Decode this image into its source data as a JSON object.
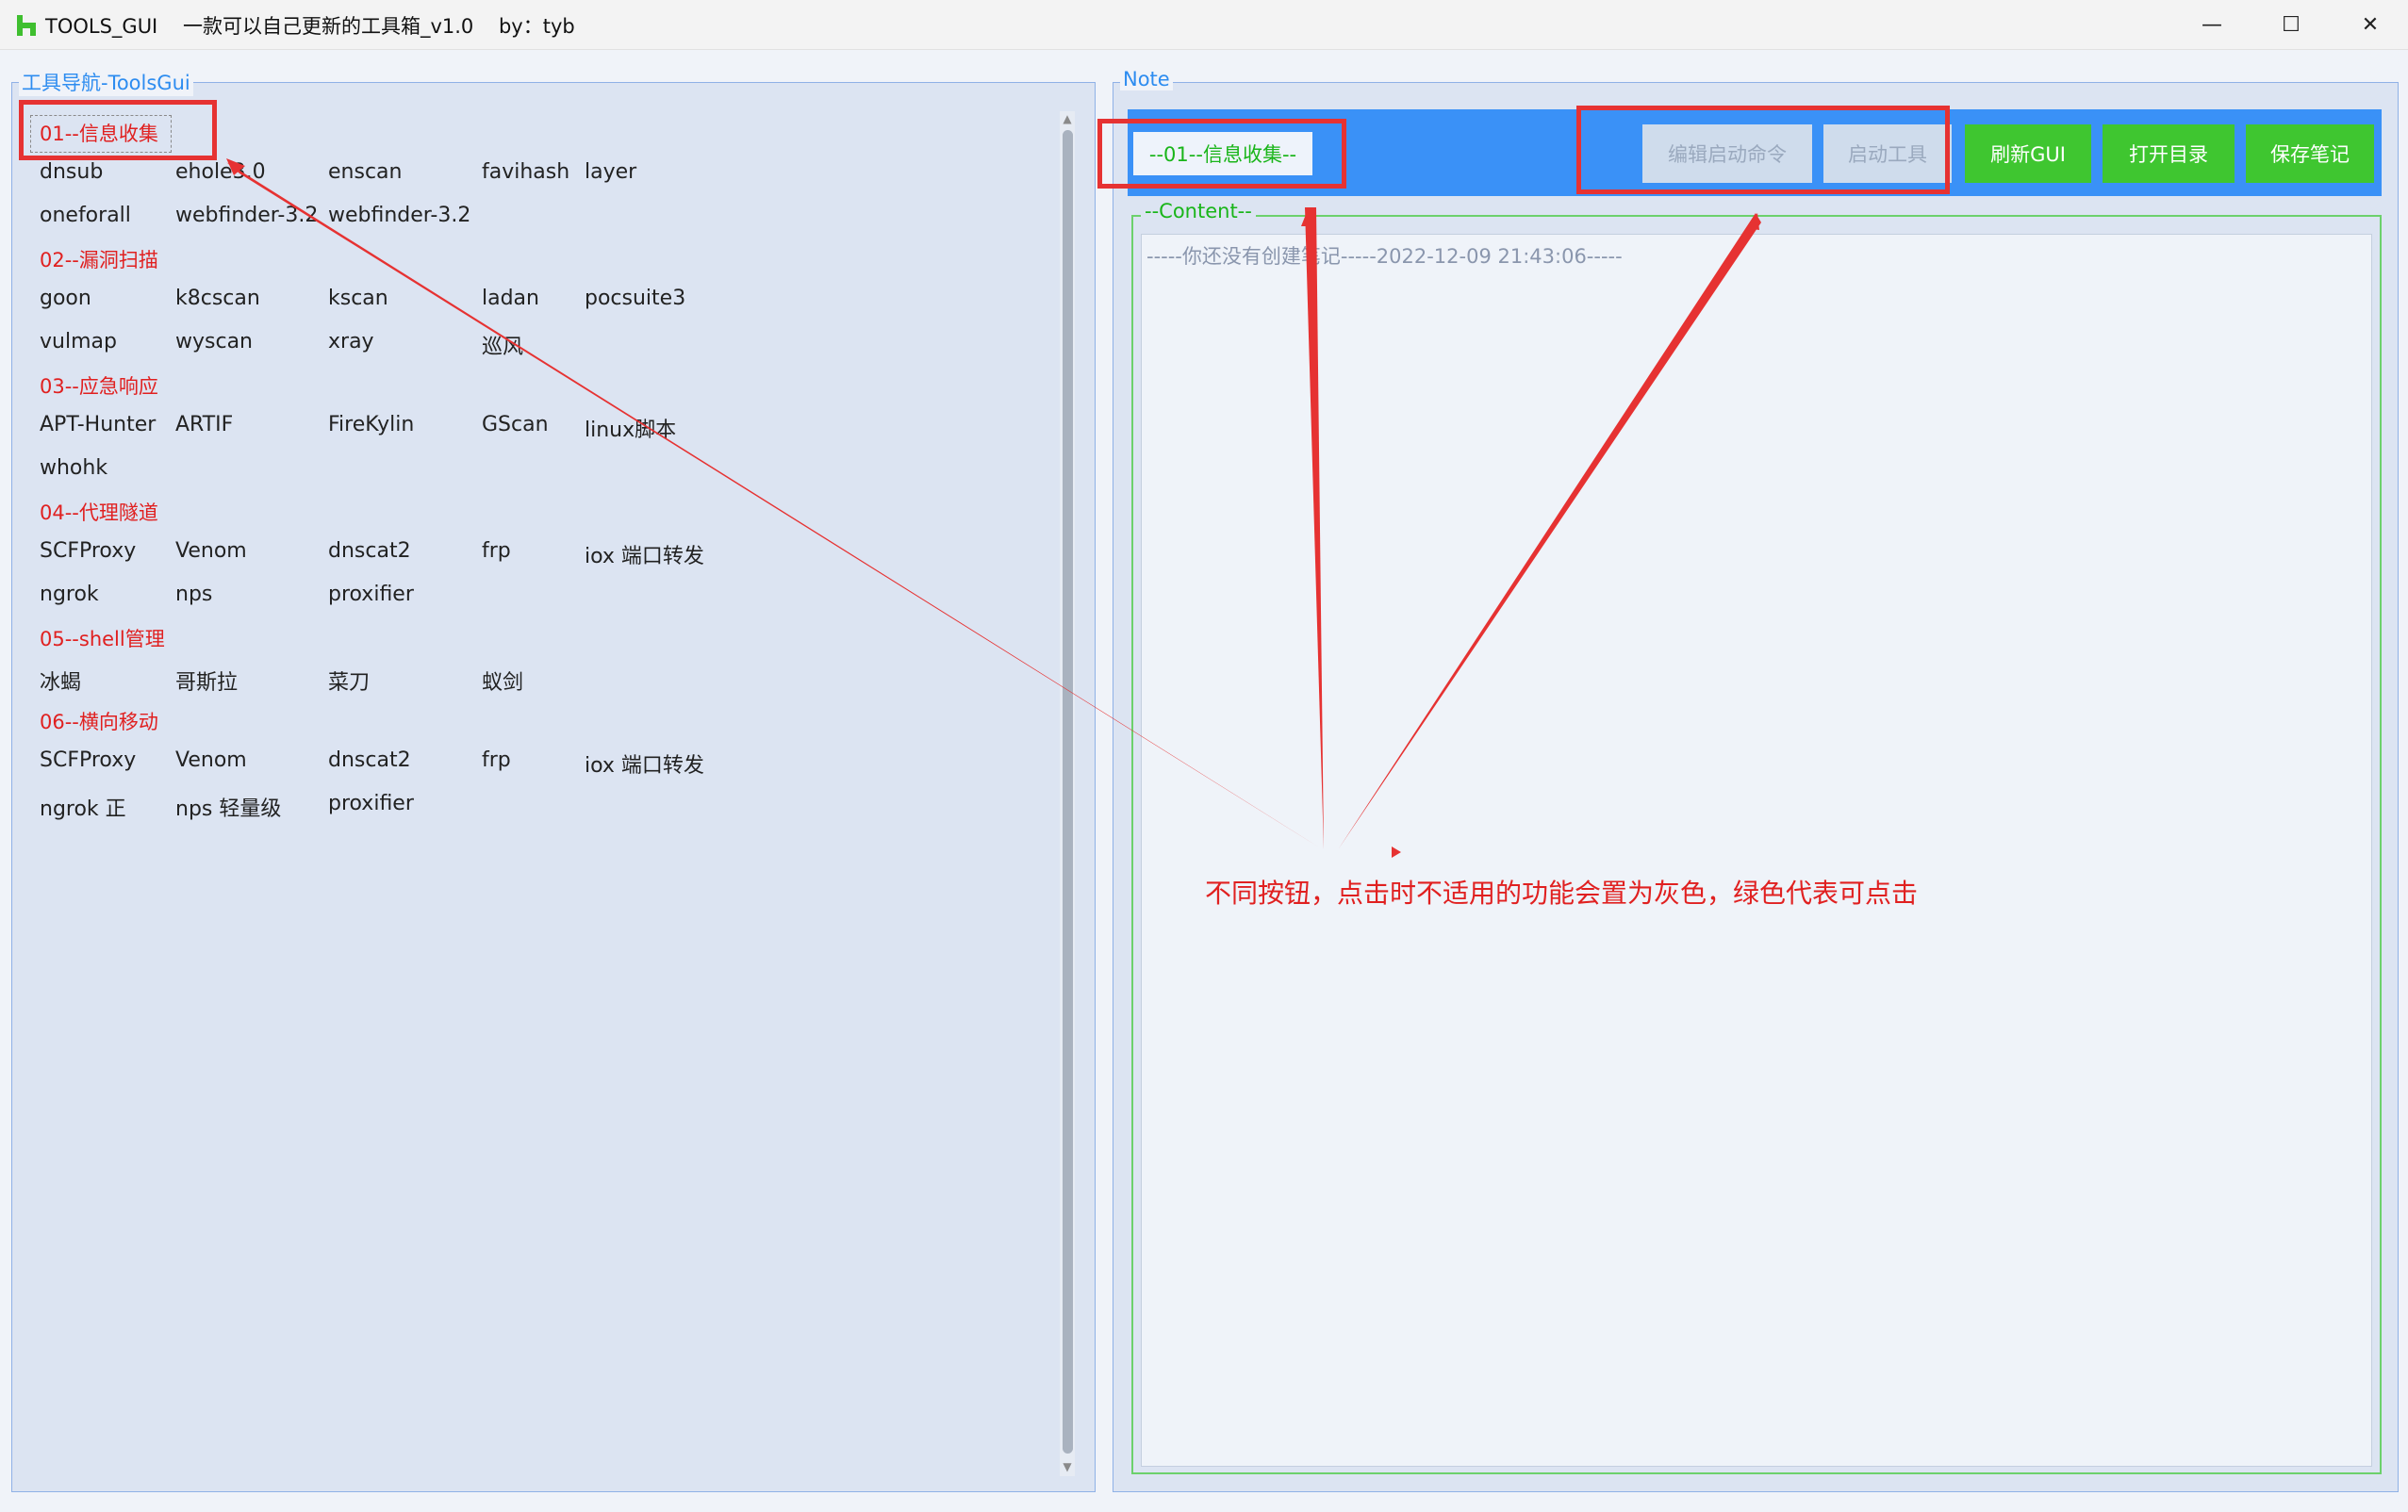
{
  "window": {
    "title": "TOOLS_GUI    一款可以自己更新的工具箱_v1.0    by：tyb",
    "controls": [
      "—",
      "☐",
      "✕"
    ]
  },
  "left_panel": {
    "title": "工具导航-ToolsGui",
    "categories": [
      {
        "label": "01--信息收集",
        "rows": [
          [
            "dnsub",
            "ehole3.0",
            "enscan",
            "favihash",
            "layer"
          ],
          [
            "oneforall",
            "webfinder-3.2",
            "webfinder-3.2"
          ]
        ]
      },
      {
        "label": "02--漏洞扫描",
        "rows": [
          [
            "goon",
            "k8cscan",
            "kscan",
            "ladan",
            "pocsuite3"
          ],
          [
            "vulmap",
            "wyscan",
            "xray",
            "巡风"
          ]
        ]
      },
      {
        "label": "03--应急响应",
        "rows": [
          [
            "APT-Hunter",
            "ARTIF",
            "FireKylin",
            "GScan",
            "linux脚本"
          ],
          [
            "whohk"
          ]
        ]
      },
      {
        "label": "04--代理隧道",
        "rows": [
          [
            "SCFProxy",
            "Venom",
            "dnscat2",
            "frp",
            "iox 端口转发"
          ],
          [
            "ngrok",
            "nps",
            "proxifier"
          ]
        ]
      },
      {
        "label": "05--shell管理",
        "rows": [
          [
            "冰蝎",
            "哥斯拉",
            "菜刀",
            "蚁剑"
          ]
        ]
      },
      {
        "label": "06--横向移动",
        "rows": [
          [
            "SCFProxy",
            "Venom",
            "dnscat2",
            "frp",
            "iox 端口转发"
          ],
          [
            "ngrok 正",
            "nps 轻量级",
            "proxifier"
          ]
        ]
      }
    ]
  },
  "right_panel": {
    "title": "Note",
    "note_label": "--01--信息收集--",
    "buttons": [
      {
        "label": "编辑启动命令",
        "enabled": false
      },
      {
        "label": "启动工具",
        "enabled": false
      },
      {
        "label": "刷新GUI",
        "enabled": true
      },
      {
        "label": "打开目录",
        "enabled": true
      },
      {
        "label": "保存笔记",
        "enabled": true
      }
    ],
    "content_title": "--Content--",
    "content_text": "-----你还没有创建笔记-----2022-12-09 21:43:06-----"
  },
  "annotation": {
    "text": "不同按钮，点击时不适用的功能会置为灰色，绿色代表可点击"
  },
  "colors": {
    "category": "#e02020",
    "toolbar": "#3a91f7",
    "enabled_button": "#3fc630",
    "disabled_button": "#cfdcec",
    "annotation": "#e63232"
  }
}
